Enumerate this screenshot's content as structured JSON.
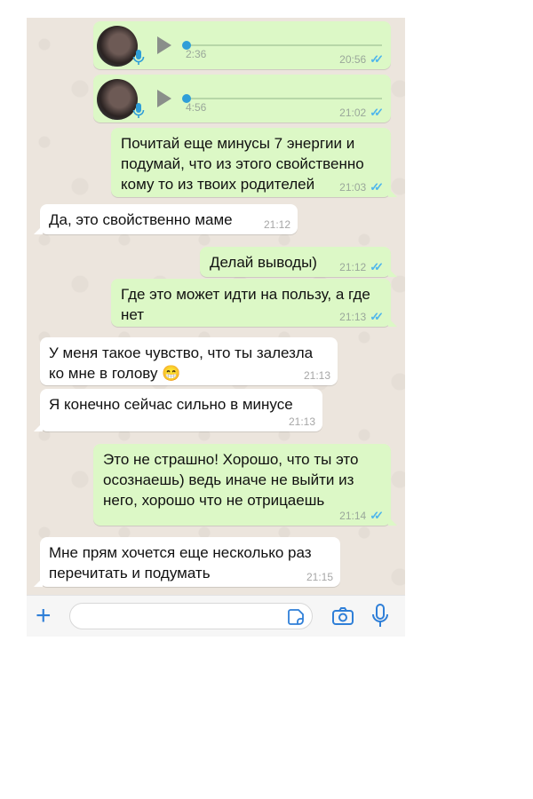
{
  "messages": [
    {
      "type": "voice",
      "direction": "out",
      "duration": "2:36",
      "time": "20:56",
      "status": "read"
    },
    {
      "type": "voice",
      "direction": "out",
      "duration": "4:56",
      "time": "21:02",
      "status": "read"
    },
    {
      "type": "text",
      "direction": "out",
      "lines": [
        "Почитай еще минусы 7 энергии и",
        "подумай, что из этого свойственно",
        "кому то из твоих родителей"
      ],
      "time": "21:03",
      "status": "read"
    },
    {
      "type": "text",
      "direction": "in",
      "lines": [
        "Да, это свойственно маме"
      ],
      "time": "21:12"
    },
    {
      "type": "text",
      "direction": "out",
      "lines": [
        "Делай выводы)"
      ],
      "time": "21:12",
      "status": "read"
    },
    {
      "type": "text",
      "direction": "out",
      "lines": [
        "Где это может идти на пользу, а где",
        "нет"
      ],
      "time": "21:13",
      "status": "read"
    },
    {
      "type": "text",
      "direction": "in",
      "lines": [
        "У меня такое чувство, что ты залезла",
        "ко мне в голову 😁"
      ],
      "time": "21:13"
    },
    {
      "type": "text",
      "direction": "in",
      "lines": [
        "Я конечно сейчас сильно в минусе"
      ],
      "time": "21:13"
    },
    {
      "type": "text",
      "direction": "out",
      "lines": [
        "Это не страшно! Хорошо, что ты это",
        "осознаешь) ведь иначе не выйти из",
        "него, хорошо что не отрицаешь"
      ],
      "time": "21:14",
      "status": "read"
    },
    {
      "type": "text",
      "direction": "in",
      "lines": [
        "Мне прям хочется еще несколько раз",
        "перечитать и подумать"
      ],
      "time": "21:15"
    }
  ],
  "input_bar": {
    "add_icon": "plus-icon",
    "field_value": "",
    "sticker_icon": "sticker-icon",
    "camera_icon": "camera-icon",
    "mic_icon": "microphone-icon"
  },
  "colors": {
    "outgoing_bubble": "#dcf8c6",
    "incoming_bubble": "#ffffff",
    "chat_background": "#ece5dd",
    "read_ticks": "#4fb6ec",
    "accent": "#2f7fd8"
  }
}
